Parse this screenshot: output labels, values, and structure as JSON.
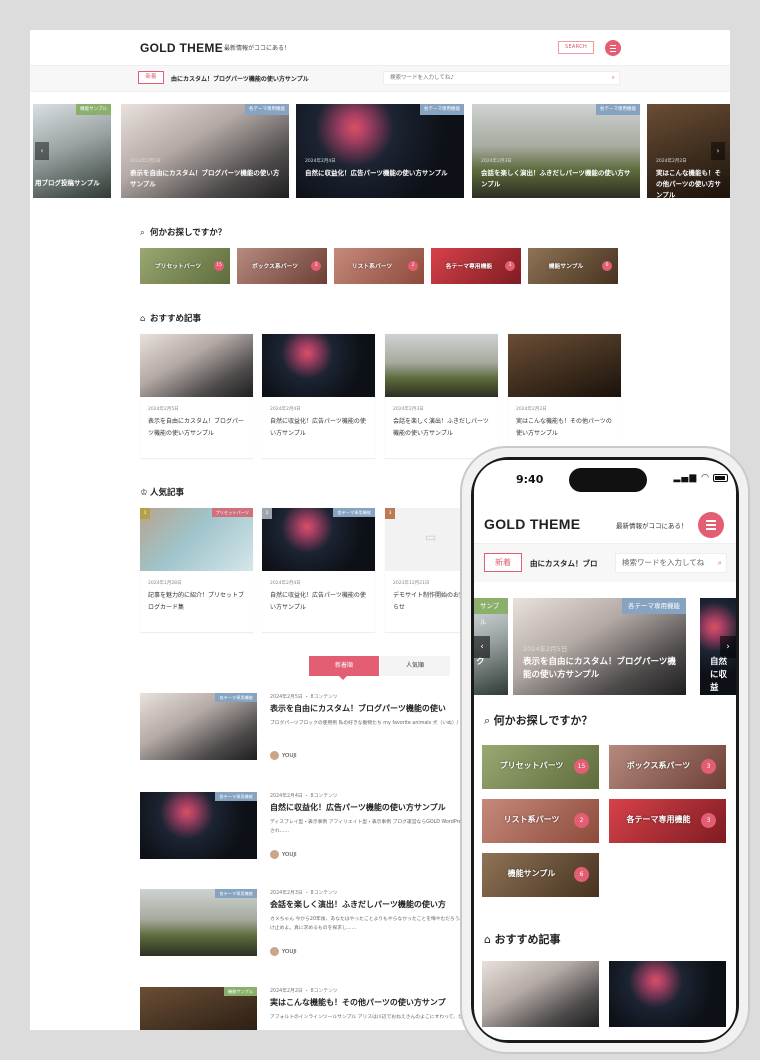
{
  "desktop": {
    "logo": "GOLD THEME",
    "tagline": "最新情報がココにある！",
    "search_button": "SEARCH",
    "news_badge": "新着",
    "news_ticker": "由にカスタム！ブログパーツ機能の使い方サンプル",
    "search_placeholder": "検索ワードを入力してね♪",
    "slider": [
      {
        "category": "機能サンプル",
        "date": "",
        "title": "用ブログ投稿サンプル"
      },
      {
        "category": "各テーマ専用機能",
        "date": "2024年2月5日",
        "title": "表示を自由にカスタム！ブログパーツ機能の使い方サンプル"
      },
      {
        "category": "各テーマ専用機能",
        "date": "2024年2月4日",
        "title": "自然に収益化！広告パーツ機能の使い方サンプル"
      },
      {
        "category": "各テーマ専用機能",
        "date": "2024年2月3日",
        "title": "会話を楽しく演出！ふきだしパーツ機能の使い方サンプル"
      },
      {
        "category": "",
        "date": "2024年2月2日",
        "title": "実はこんな機能も！その他パーツの使い方サンプル"
      }
    ],
    "search_section_title": "何かお探しですか？",
    "categories": [
      {
        "label": "プリセットパーツ",
        "count": "15"
      },
      {
        "label": "ボックス系パーツ",
        "count": "3"
      },
      {
        "label": "リスト系パーツ",
        "count": "2"
      },
      {
        "label": "各テーマ専用機能",
        "count": "3"
      },
      {
        "label": "機能サンプル",
        "count": "6"
      }
    ],
    "recommended_title": "おすすめ記事",
    "recommended": [
      {
        "date": "2024年2月5日",
        "title": "表示を自由にカスタム！ブログパーツ機能の使い方サンプル"
      },
      {
        "date": "2024年2月4日",
        "title": "自然に収益化！広告パーツ機能の使い方サンプル"
      },
      {
        "date": "2024年2月3日",
        "title": "会話を楽しく演出！ふきだしパーツ機能の使い方サンプル"
      },
      {
        "date": "2024年2月2日",
        "title": "実はこんな機能も！その他パーツの使い方サンプル"
      }
    ],
    "popular_title": "人気記事",
    "popular": [
      {
        "rank": "1",
        "category": "プリセットパーツ",
        "date": "2024年1月28日",
        "title": "記事を魅力的に紹介！プリセットブログカード集"
      },
      {
        "rank": "2",
        "category": "各テーマ専用機能",
        "date": "2024年2月4日",
        "title": "自然に収益化！広告パーツ機能の使い方サンプル"
      },
      {
        "rank": "3",
        "category": "",
        "date": "2023年12月21日",
        "title": "デモサイト制作開始のお知らせ"
      }
    ],
    "tab_new": "新着順",
    "tab_popular": "人気順",
    "posts": [
      {
        "category": "各テーマ専用機能",
        "meta": "2024年2月5日 ・ 8コンテンツ",
        "title": "表示を自由にカスタム！ブログパーツ機能の使い",
        "excerpt": "ブログパーツブロックの使用例 私の好きな動物たち my favorite animals 犬（いぬ）/ dog 私たちの最も親しい友達 squir……",
        "author": "YOUJI"
      },
      {
        "category": "各テーマ専用機能",
        "meta": "2024年2月4日 ・ 8コンテンツ",
        "title": "自然に収益化！広告パーツ機能の使い方サンプル",
        "excerpt": "ディスプレイ型・表示事例 アフィリエイト型・表示事例 ブログ運営ならGOLD WordPress初心者でも簡単に、おしゃれで・美しい・洗練され……",
        "author": "YOUJI"
      },
      {
        "category": "各テーマ専用機能",
        "meta": "2024年2月3日 ・ 8コンテンツ",
        "title": "会話を楽しく演出！ふきだしパーツ機能の使い方",
        "excerpt": "カメちゃん 今から20年後、あなたはやったことよりもやらなかったことを悔やむだろう。安全な港を出発せよ。自分自身の帆で貿易風を受け止めよ。真に求めるものを探求し……",
        "author": "YOUJI"
      },
      {
        "category": "機能サンプル",
        "meta": "2024年2月2日 ・ 8コンテンツ",
        "title": "実はこんな機能も！その他パーツの使い方サンプ",
        "excerpt": "アフォルトのインラインツールサンプル アリスは川辺でおねえさんのよこにすわって、なんにもすることがないので……",
        "author": ""
      }
    ]
  },
  "mobile": {
    "time": "9:40",
    "logo": "GOLD THEME",
    "tagline": "最新情報がココにある！",
    "news_badge": "新着",
    "news_ticker": "由にカスタム！ブロ",
    "search_placeholder": "検索ワードを入力してね",
    "slider": [
      {
        "category": "サンプル",
        "date": "",
        "title": "ク"
      },
      {
        "category": "各テーマ専用機能",
        "date": "2024年2月5日",
        "title": "表示を自由にカスタム！ブログパーツ機能の使い方サンプル"
      },
      {
        "category": "",
        "date": "",
        "title": "自然に収益化！広告パーツ機能の使い"
      }
    ],
    "search_section_title": "何かお探しですか？",
    "categories": [
      {
        "label": "プリセットパーツ",
        "count": "15"
      },
      {
        "label": "ボックス系パーツ",
        "count": "3"
      },
      {
        "label": "リスト系パーツ",
        "count": "2"
      },
      {
        "label": "各テーマ専用機能",
        "count": "3"
      },
      {
        "label": "機能サンプル",
        "count": "6"
      }
    ],
    "recommended_title": "おすすめ記事"
  },
  "colors": {
    "accent": "#e35d73",
    "category_blue": "#86a3c1",
    "category_green": "#8ab06b"
  }
}
